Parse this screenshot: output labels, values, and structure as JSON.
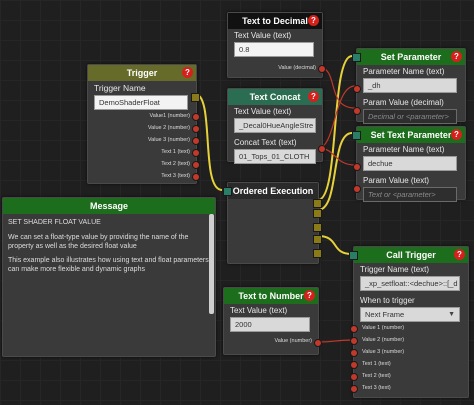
{
  "nodes": {
    "text_to_decimal": {
      "title": "Text to Decimal",
      "field_label": "Text Value (text)",
      "field_value": "0.8",
      "output": "Value (decimal)"
    },
    "trigger": {
      "title": "Trigger",
      "field_label": "Trigger Name",
      "field_value": "DemoShaderFloat",
      "outputs": [
        "Value1 (number)",
        "Value 2 (number)",
        "Value 3 (number)",
        "Text 1 (text)",
        "Text 2 (text)",
        "Text 3 (text)"
      ]
    },
    "text_concat": {
      "title": "Text Concat",
      "field1_label": "Text Value (text)",
      "field1_value": "_Decal0HueAngleStre",
      "field2_label": "Concat Text (text)",
      "field2_value": "01_Tops_01_CLOTH"
    },
    "set_parameter": {
      "title": "Set Parameter",
      "field1_label": "Parameter Name (text)",
      "field1_value": "_dh",
      "field2_label": "Param Value (decimal)",
      "field2_placeholder": "Decimal or <parameter>"
    },
    "set_text_parameter": {
      "title": "Set Text Parameter",
      "field1_label": "Parameter Name (text)",
      "field1_value": "dechue",
      "field2_label": "Param Value (text)",
      "field2_placeholder": "Text or <parameter>"
    },
    "message": {
      "title": "Message",
      "p1": "SET SHADER FLOAT VALUE",
      "p2": "We can set a float-type value by providing the name of the property as well as the desired float value",
      "p3": "This example also illustrates how using text and float parameters can make more flexible and dynamic graphs"
    },
    "ordered_execution": {
      "title": "Ordered Execution"
    },
    "text_to_number": {
      "title": "Text to Number",
      "field_label": "Text Value (text)",
      "field_value": "2000",
      "output": "Value (number)"
    },
    "call_trigger": {
      "title": "Call Trigger",
      "field_label": "Trigger Name (text)",
      "field_value": "_xp_setfloat::<dechue>::[_d",
      "when_label": "When to trigger",
      "when_value": "Next Frame",
      "inputs": [
        "Value 1 (number)",
        "Value 2 (number)",
        "Value 3 (number)",
        "Text 1 (text)",
        "Text 2 (text)",
        "Text 3 (text)"
      ]
    }
  },
  "help_glyph": "?",
  "colors": {
    "wire_yellow": "#e8d23a",
    "wire_red": "#c0392b",
    "header_green": "#1c6e1c",
    "header_olive": "#666b2a"
  }
}
